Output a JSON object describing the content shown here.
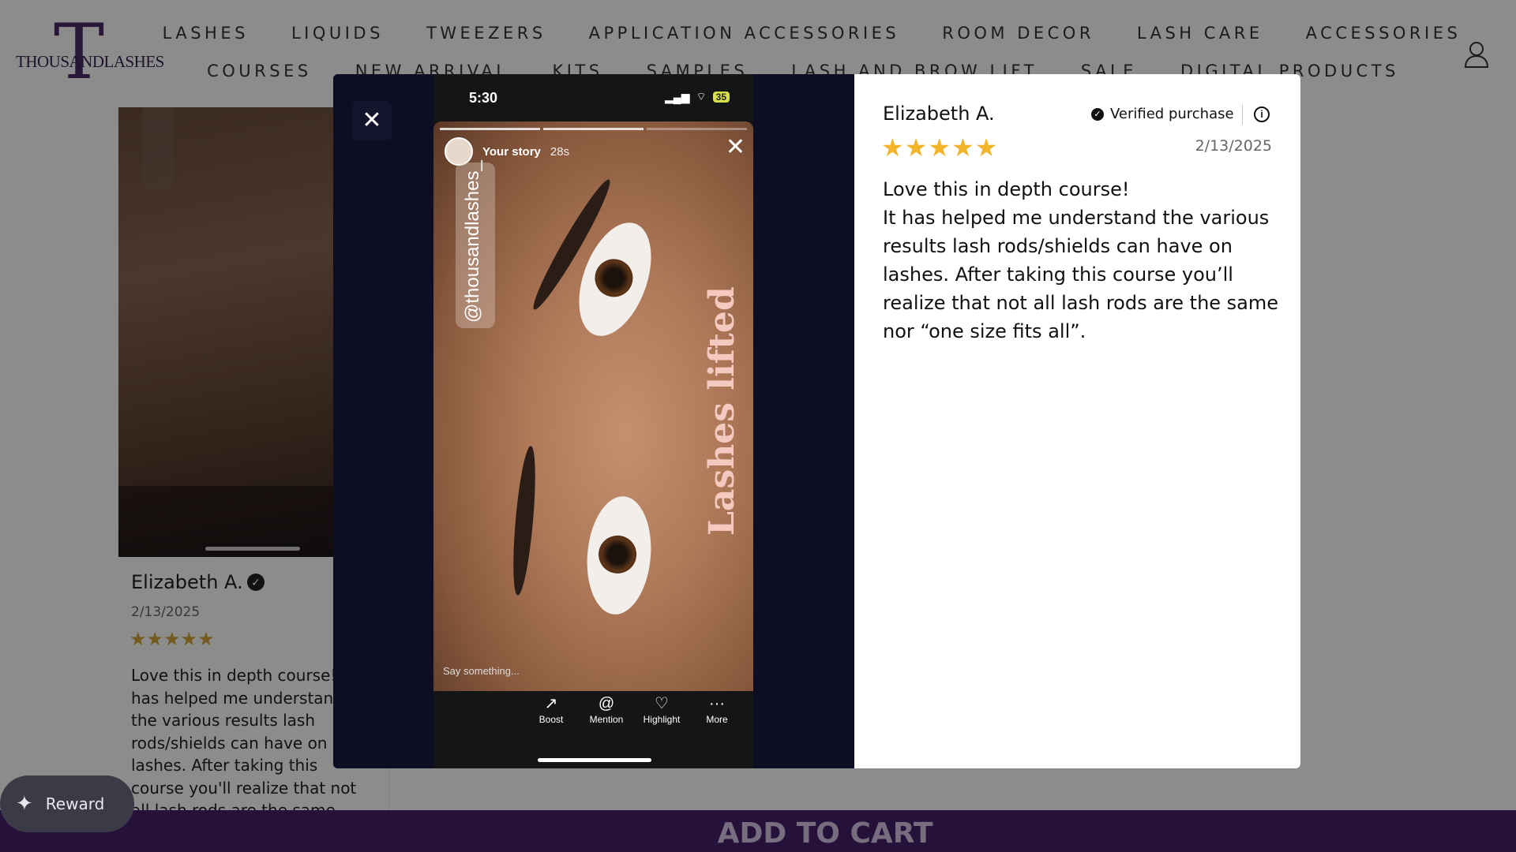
{
  "brand": {
    "logo_mark": "T",
    "wordmark": "THOUSANDLASHES"
  },
  "nav": {
    "row1": [
      "LASHES",
      "LIQUIDS",
      "TWEEZERS",
      "APPLICATION ACCESSORIES",
      "ROOM DECOR",
      "LASH CARE",
      "ACCESSORIES"
    ],
    "row2": [
      "COURSES",
      "NEW ARRIVAL",
      "KITS",
      "SAMPLES",
      "LASH AND BROW LIFT",
      "SALE",
      "DIGITAL PRODUCTS"
    ]
  },
  "background_review": {
    "name": "Elizabeth A.",
    "date": "2/13/2025",
    "stars": "★★★★★",
    "text": "Love this in depth course! It has helped me understand the various results lash rods/shields can have on lashes.  After taking this course you'll realize that not all lash rods are the same"
  },
  "modal": {
    "close_glyph": "✕",
    "phone": {
      "time": "5:30",
      "battery": "35",
      "story_user": "Your story",
      "story_age": "28s",
      "handle": "@thousandlashes_",
      "overlay_text": "Lashes lifted",
      "say_placeholder": "Say something...",
      "actions": [
        {
          "label": "Boost",
          "glyph": "↗"
        },
        {
          "label": "Mention",
          "glyph": "@"
        },
        {
          "label": "Highlight",
          "glyph": "♡"
        },
        {
          "label": "More",
          "glyph": "···"
        }
      ]
    },
    "review": {
      "name": "Elizabeth A.",
      "verified_label": "Verified purchase",
      "stars": "★★★★★",
      "date": "2/13/2025",
      "body": "Love this in depth course!\nIt has helped me understand the various results lash rods/shields can have on lashes.  After taking this course you’ll realize that not all lash rods are the same nor “one size fits all”."
    }
  },
  "bottom": {
    "cart_label": "ADD TO CART",
    "reward_label": "Reward"
  },
  "colors": {
    "brand_purple": "#46206a",
    "star_gold": "#f2b52a",
    "modal_dark": "#0d0e24"
  }
}
